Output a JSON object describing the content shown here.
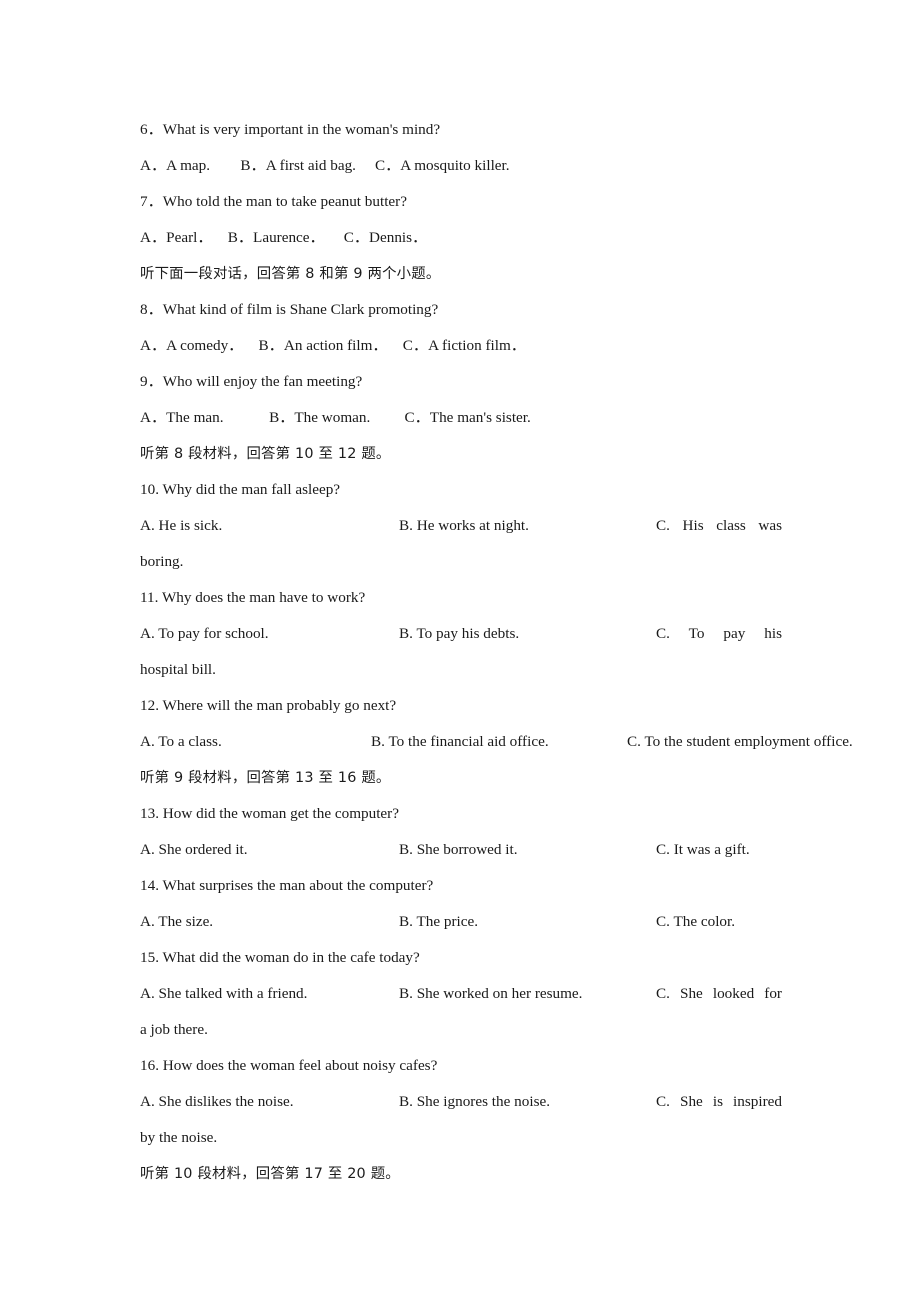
{
  "document": {
    "type": "listening-comprehension-exam-page",
    "language": "English with Chinese instructions"
  },
  "blocks": [
    {
      "id": "q6",
      "kind": "question",
      "stem": "6．What is very important in the woman's mind?",
      "options_line": "A．A map.        B．A first aid bag.     C．A mosquito killer."
    },
    {
      "id": "q7",
      "kind": "question",
      "stem": "7．Who told the man to take peanut butter?",
      "options_line": "A．Pearl．    B．Laurence．     C．Dennis．"
    },
    {
      "id": "inst1",
      "kind": "instruction",
      "text": "听下面一段对话，回答第 8 和第 9 两个小题。"
    },
    {
      "id": "q8",
      "kind": "question",
      "stem": "8．What kind of film is Shane Clark promoting?",
      "options_line": "A．A comedy．    B．An action film．    C．A fiction film．"
    },
    {
      "id": "q9",
      "kind": "question",
      "stem": "9．Who will enjoy the fan meeting?",
      "options_line": "A．The man.            B．The woman.         C．The man's sister."
    },
    {
      "id": "inst2",
      "kind": "instruction",
      "text": "听第 8 段材料，回答第 10 至 12 题。"
    },
    {
      "id": "q10",
      "kind": "question-cols",
      "stem": "10. Why did the man fall asleep?",
      "optionA": "A. He is sick.",
      "optionB": "B. He works at night.",
      "optionC": "C. His class was",
      "continuation": "boring.",
      "justified": true
    },
    {
      "id": "q11",
      "kind": "question-cols",
      "stem": "11. Why does the man have to work?",
      "optionA": "A. To pay for school.",
      "optionB": "B. To pay his debts.",
      "optionC": "C. To pay his",
      "continuation": "hospital bill.",
      "justified": true
    },
    {
      "id": "q12",
      "kind": "question-cols-tight",
      "stem": "12. Where will the man probably go next?",
      "optionA": "A. To a class.",
      "optionB": "B. To the financial aid office.",
      "optionC": "C. To the student employment office.",
      "justified": false
    },
    {
      "id": "inst3",
      "kind": "instruction",
      "text": "听第 9 段材料，回答第 13 至 16 题。"
    },
    {
      "id": "q13",
      "kind": "question-cols",
      "stem": "13. How did the woman get the computer?",
      "optionA": "A. She ordered it.",
      "optionB": "B. She borrowed it.",
      "optionC": "C. It was a gift.",
      "justified": false
    },
    {
      "id": "q14",
      "kind": "question-cols",
      "stem": "14. What surprises the man about the computer?",
      "optionA": "A. The size.",
      "optionB": "B. The price.",
      "optionC": "C. The color.",
      "justified": false
    },
    {
      "id": "q15",
      "kind": "question-cols",
      "stem": "15. What did the woman do in the cafe today?",
      "optionA": "A. She talked with a friend.",
      "optionB": "B. She worked on her resume.",
      "optionC": "C. She looked for",
      "continuation": "a job there.",
      "justified": true
    },
    {
      "id": "q16",
      "kind": "question-cols",
      "stem": "16. How does the woman feel about noisy cafes?",
      "optionA": "A. She dislikes the noise.",
      "optionB": "B. She ignores the noise.",
      "optionC": "C. She is inspired",
      "continuation": "by the noise.",
      "justified": true
    },
    {
      "id": "inst4",
      "kind": "instruction",
      "text": "听第 10 段材料，回答第 17 至 20 题。"
    }
  ]
}
